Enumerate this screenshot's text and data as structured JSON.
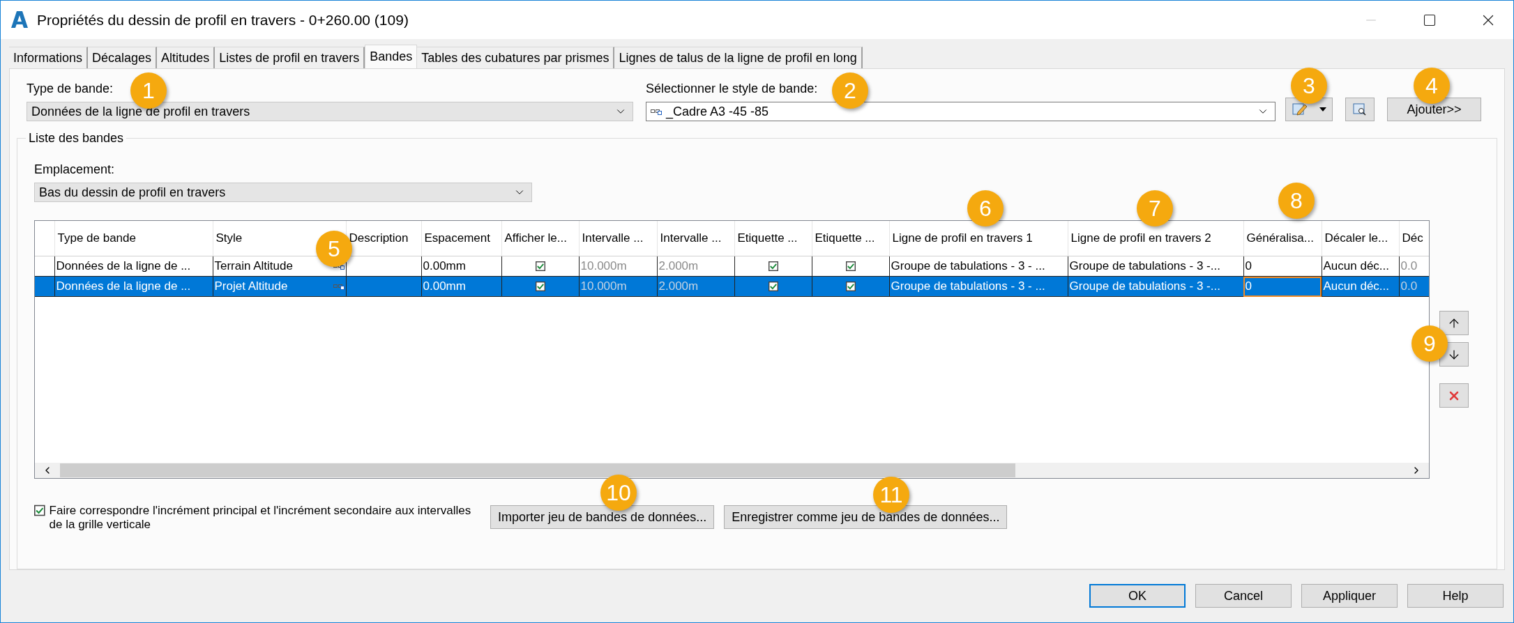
{
  "window": {
    "title": "Propriétés du dessin de profil en travers - 0+260.00 (109)"
  },
  "tabs": [
    {
      "label": "Informations",
      "selected": false
    },
    {
      "label": "Décalages",
      "selected": false
    },
    {
      "label": "Altitudes",
      "selected": false
    },
    {
      "label": "Listes de profil en travers",
      "selected": false
    },
    {
      "label": "Bandes",
      "selected": true
    },
    {
      "label": "Tables des cubatures par prismes",
      "selected": false
    },
    {
      "label": "Lignes de talus de la ligne de profil en long",
      "selected": false
    }
  ],
  "band_type": {
    "label": "Type de bande:",
    "value": "Données de la ligne de profil en travers"
  },
  "band_style": {
    "label": "Sélectionner le style de bande:",
    "value": "_Cadre A3 -45 -85"
  },
  "add_button": "Ajouter>>",
  "band_list": {
    "title": "Liste des bandes",
    "location": {
      "label": "Emplacement:",
      "value": "Bas du dessin de profil en travers"
    },
    "columns": [
      "",
      "Type de bande",
      "Style",
      "Description",
      "Espacement",
      "Afficher le...",
      "Intervalle ...",
      "Intervalle ...",
      "Etiquette ...",
      "Etiquette ...",
      "Ligne de profil en travers 1",
      "Ligne de profil en travers 2",
      "Généralisa...",
      "Décaler le...",
      "Déc"
    ],
    "rows": [
      {
        "selected": false,
        "cells": [
          {
            "kind": "text",
            "text": ""
          },
          {
            "kind": "text",
            "text": "Données de la ligne de ..."
          },
          {
            "kind": "style",
            "text": "Terrain Altitude"
          },
          {
            "kind": "text",
            "text": ""
          },
          {
            "kind": "text",
            "text": "0.00mm"
          },
          {
            "kind": "check",
            "checked": true
          },
          {
            "kind": "text",
            "text": "10.000m",
            "disabled": true
          },
          {
            "kind": "text",
            "text": "2.000m",
            "disabled": true
          },
          {
            "kind": "check",
            "checked": true
          },
          {
            "kind": "check",
            "checked": true
          },
          {
            "kind": "text",
            "text": "Groupe de tabulations - 3 - ..."
          },
          {
            "kind": "text",
            "text": "Groupe de tabulations - 3 -..."
          },
          {
            "kind": "text",
            "text": "0"
          },
          {
            "kind": "text",
            "text": "Aucun déc..."
          },
          {
            "kind": "text",
            "text": "0.0",
            "disabled": true
          }
        ]
      },
      {
        "selected": true,
        "cells": [
          {
            "kind": "text",
            "text": ""
          },
          {
            "kind": "text",
            "text": "Données de la ligne de ..."
          },
          {
            "kind": "style",
            "text": "Projet Altitude"
          },
          {
            "kind": "text",
            "text": ""
          },
          {
            "kind": "text",
            "text": "0.00mm"
          },
          {
            "kind": "check",
            "checked": true
          },
          {
            "kind": "text",
            "text": "10.000m",
            "disabled": true
          },
          {
            "kind": "text",
            "text": "2.000m",
            "disabled": true
          },
          {
            "kind": "check",
            "checked": true
          },
          {
            "kind": "check",
            "checked": true
          },
          {
            "kind": "text",
            "text": "Groupe de tabulations - 3 - ..."
          },
          {
            "kind": "text",
            "text": "Groupe de tabulations - 3 -..."
          },
          {
            "kind": "text",
            "text": "0",
            "focused": true
          },
          {
            "kind": "text",
            "text": "Aucun déc..."
          },
          {
            "kind": "text",
            "text": "0.0",
            "disabled": true
          }
        ]
      }
    ]
  },
  "match_checkbox": {
    "label": "Faire correspondre l'incrément principal et l'incrément secondaire aux intervalles de la grille verticale",
    "checked": true
  },
  "import_button": "Importer jeu de bandes de données...",
  "save_button": "Enregistrer comme jeu de bandes de données...",
  "footer_buttons": [
    {
      "label": "OK",
      "default": true
    },
    {
      "label": "Cancel",
      "default": false
    },
    {
      "label": "Appliquer",
      "default": false
    },
    {
      "label": "Help",
      "default": false
    }
  ],
  "callouts": [
    "1",
    "2",
    "3",
    "4",
    "5",
    "6",
    "7",
    "8",
    "9",
    "10",
    "11"
  ]
}
